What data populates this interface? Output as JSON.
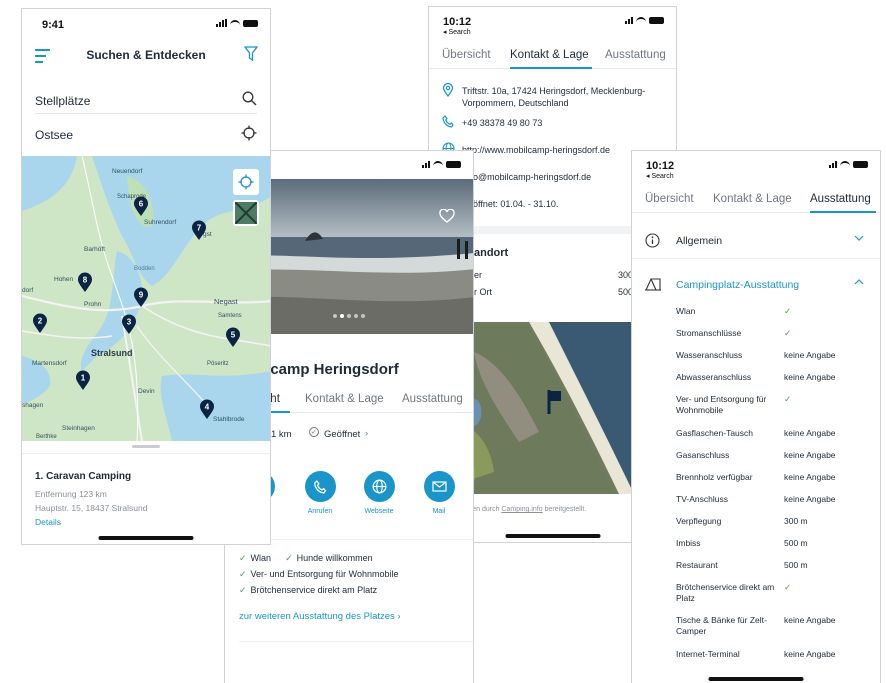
{
  "colors": {
    "accent": "#1a95c9",
    "check": "#37a847",
    "pin": "#0c2444"
  },
  "screen1": {
    "time": "9:41",
    "title": "Suchen & Entdecken",
    "search_label": "Stellplätze",
    "location_label": "Ostsee",
    "map_labels": [
      "Neuendorf",
      "Schaprode",
      "Suhrendorf",
      "Barhöft",
      "Hohen",
      "Prohn",
      "Negast",
      "Samtens",
      "Stralsund",
      "Martensdorf",
      "Devin",
      "Pöseritz",
      "Stahlbrode",
      "Steinhagen",
      "Berthke",
      "shagen",
      "dorf",
      "Bodden",
      "gst"
    ],
    "map_markers": [
      "6",
      "7",
      "8",
      "9",
      "2",
      "3",
      "5",
      "1",
      "4"
    ],
    "result_name": "1. Caravan Camping",
    "result_distance": "Entfernung 123 km",
    "result_address": "Hauptstr. 15, 18437 Stralsund",
    "result_details": "Details"
  },
  "screen2": {
    "title_partial": "ilcamp Heringsdorf",
    "tabs": [
      "icht",
      "Kontakt & Lage",
      "Ausstattung"
    ],
    "distance": "1 km",
    "status": "Geöffnet",
    "actions": [
      {
        "label": "Anrufen",
        "icon": "phone-icon"
      },
      {
        "label": "Webseite",
        "icon": "globe-icon"
      },
      {
        "label": "Mail",
        "icon": "mail-icon"
      }
    ],
    "features_row1": [
      "Wlan",
      "Hunde willkommen"
    ],
    "features": [
      "Ver- und Entsorgung für Wohnmobile",
      "Brötchenservice direkt am Platz"
    ],
    "more_link": "zur weiteren Ausstattung des Platzes"
  },
  "screen3": {
    "time": "10:12",
    "back": "◂ Search",
    "tabs": [
      "Übersicht",
      "Kontakt & Lage",
      "Ausstattung"
    ],
    "address": "Triftstr. 10a, 17424 Heringsdorf, Mecklenburg-Vorpommern, Deutschland",
    "phone": "+49 38378 49 80 73",
    "website": "http://www.mobilcamp-heringsdorf.de",
    "email_partial": "o@mobilcamp-heringsdorf.de",
    "season_partial": "öffnet: 01.04. - 31.10.",
    "section_partial": "andort",
    "rows": [
      {
        "label": "er",
        "value": "300 m"
      },
      {
        "label": "r Ort",
        "value": "500 m"
      }
    ],
    "credit_partial": "rden durch",
    "credit_link": "Camping.info",
    "credit_tail": "bereitgestellt."
  },
  "screen4": {
    "time": "10:12",
    "back": "◂ Search",
    "tabs": [
      "Übersicht",
      "Kontakt & Lage",
      "Ausstattung"
    ],
    "general": "Allgemein",
    "section": "Campingplatz-Ausstattung",
    "rows": [
      {
        "label": "Wlan",
        "value": "✓"
      },
      {
        "label": "Stromanschlüsse",
        "value": "✓"
      },
      {
        "label": "Wasseranschluss",
        "value": "keine Angabe"
      },
      {
        "label": "Abwasseranschluss",
        "value": "keine Angabe"
      },
      {
        "label": "Ver- und Entsorgung für Wohnmobile",
        "value": "✓"
      },
      {
        "label": "Gasflaschen-Tausch",
        "value": "keine Angabe"
      },
      {
        "label": "Gasanschluss",
        "value": "keine Angabe"
      },
      {
        "label": "Brennholz verfügbar",
        "value": "keine Angabe"
      },
      {
        "label": "TV-Anschluss",
        "value": "keine Angabe"
      },
      {
        "label": "Verpflegung",
        "value": "300 m"
      },
      {
        "label": "Imbiss",
        "value": "500 m"
      },
      {
        "label": "Restaurant",
        "value": "500 m"
      },
      {
        "label": "Brötchenservice direkt am Platz",
        "value": "✓"
      },
      {
        "label": "Tische & Bänke für Zelt-Camper",
        "value": "keine Angabe"
      },
      {
        "label": "Internet-Terminal",
        "value": "keine Angabe"
      }
    ]
  }
}
